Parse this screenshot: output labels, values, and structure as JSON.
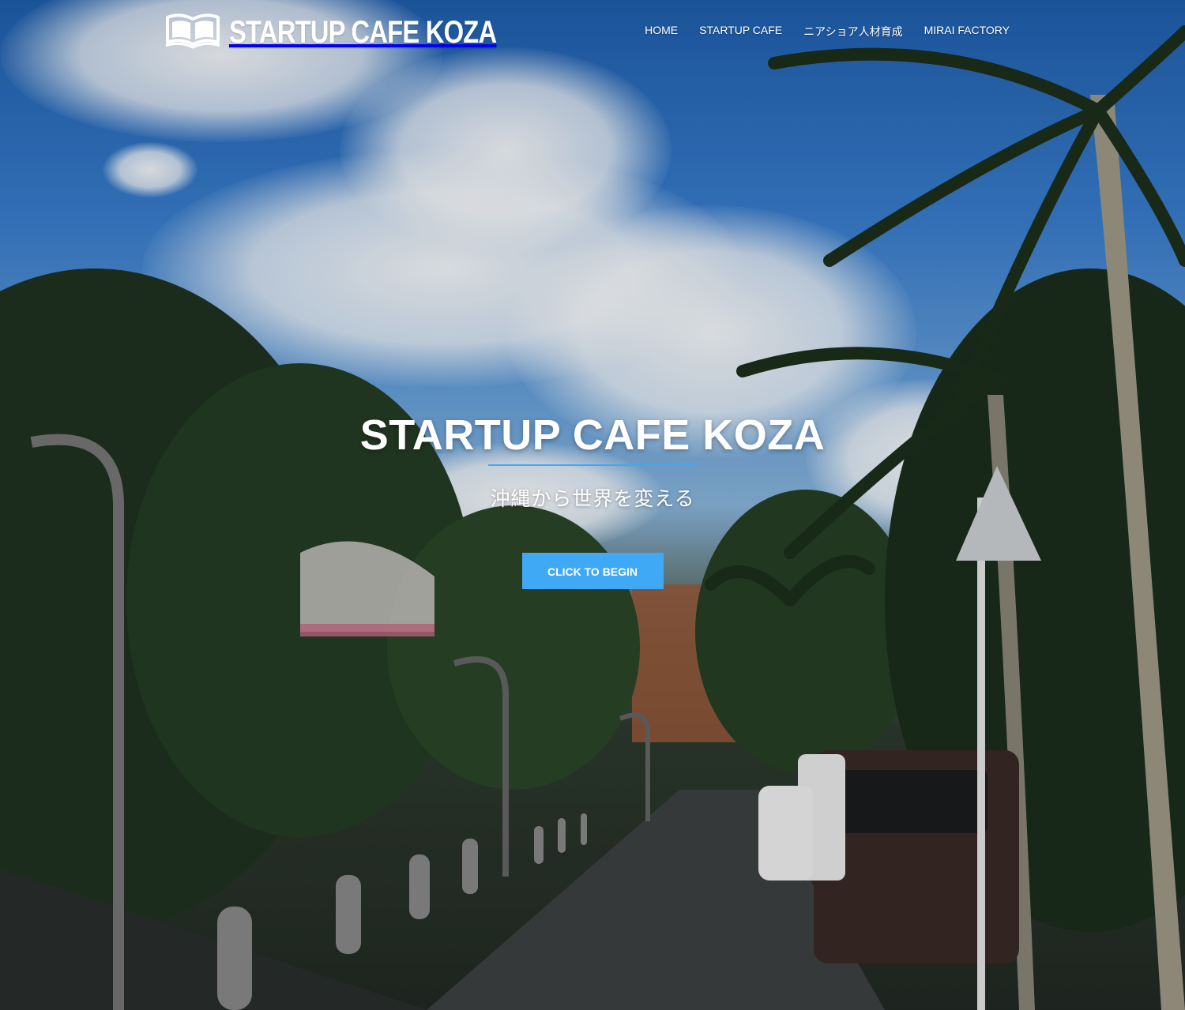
{
  "brand": {
    "logo_text": "STARTUP CAFE KOZA",
    "logo_icon": "open-book-icon"
  },
  "nav": {
    "items": [
      {
        "label": "HOME"
      },
      {
        "label": "STARTUP CAFE"
      },
      {
        "label": "ニアショア人材育成"
      },
      {
        "label": "MIRAI FACTORY"
      }
    ]
  },
  "hero": {
    "title": "STARTUP CAFE KOZA",
    "subtitle": "沖縄から世界を変える",
    "cta_label": "CLICK TO BEGIN"
  },
  "colors": {
    "accent": "#3fa9f5",
    "text": "#ffffff"
  }
}
